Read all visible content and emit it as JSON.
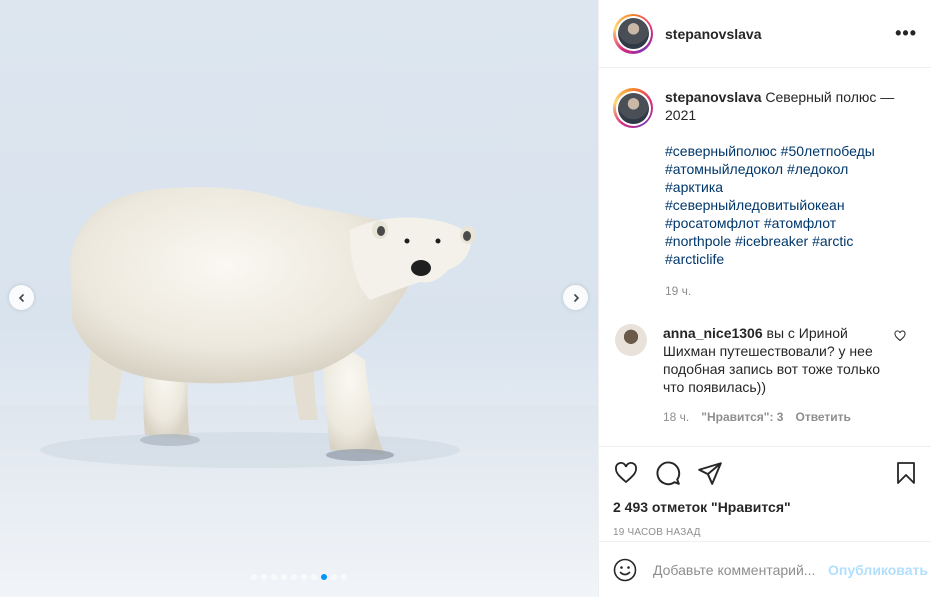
{
  "post": {
    "username": "stepanovslava",
    "caption": "Северный полюс — 2021",
    "hashtags": [
      "#северныйполюс",
      "#50летпобеды",
      "#атомныйледокол",
      "#ледокол",
      "#арктика",
      "#северныйледовитыйокеан",
      "#росатомфлот",
      "#атомфлот",
      "#northpole",
      "#icebreaker",
      "#arctic",
      "#arcticlife"
    ],
    "caption_time": "19 ч.",
    "likes": "2 493 отметок \"Нравится\"",
    "posted_ago": "19 ЧАСОВ НАЗАД"
  },
  "carousel": {
    "slide_count": 10,
    "active_index": 7
  },
  "comment": {
    "username": "anna_nice1306",
    "text": "вы с Ириной Шихман путешествовали? у нее подобная запись вот тоже только что появилась))",
    "time": "18 ч.",
    "likes": "\"Нравится\": 3",
    "reply": "Ответить"
  },
  "add_comment": {
    "placeholder": "Добавьте комментарий...",
    "submit": "Опубликовать"
  },
  "icons": {
    "more": "more-options-icon",
    "like": "heart-icon",
    "comment": "comment-icon",
    "share": "send-icon",
    "save": "bookmark-icon",
    "emoji": "emoji-icon"
  },
  "colors": {
    "hashtag": "#00376b",
    "active_dot": "#0095f6",
    "publish_disabled": "#b2dffc"
  }
}
